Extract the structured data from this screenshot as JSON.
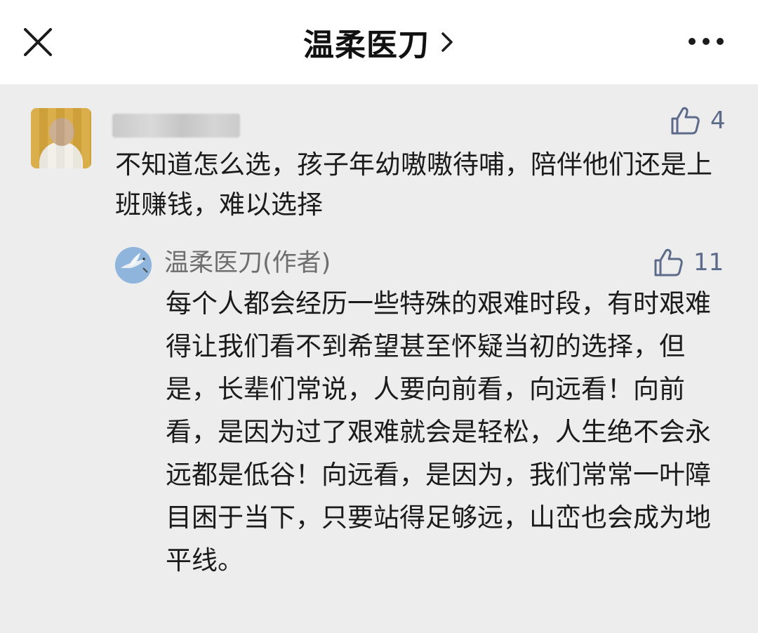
{
  "header": {
    "title": "温柔医刀",
    "close_icon": "close-icon",
    "more_icon": "more-horizontal-icon",
    "chevron_icon": "chevron-right-icon"
  },
  "comment": {
    "avatar_icon": "user-avatar",
    "like_icon": "thumbs-up-icon",
    "like_count": "4",
    "text": "不知道怎么选，孩子年幼嗷嗷待哺，陪伴他们还是上班赚钱，难以选择"
  },
  "reply": {
    "avatar_icon": "bird-avatar",
    "author": "温柔医刀(作者)",
    "like_icon": "thumbs-up-icon",
    "like_count": "11",
    "text": "每个人都会经历一些特殊的艰难时段，有时艰难得让我们看不到希望甚至怀疑当初的选择，但是，长辈们常说，人要向前看，向远看！向前看，是因为过了艰难就会是轻松，人生绝不会永远都是低谷！向远看，是因为，我们常常一叶障目困于当下，只要站得足够远，山峦也会成为地平线。"
  },
  "colors": {
    "page_background": "#ededed",
    "topbar_background": "#ffffff",
    "like_color": "#5d6b8a",
    "author_color": "#6e6e6e"
  }
}
